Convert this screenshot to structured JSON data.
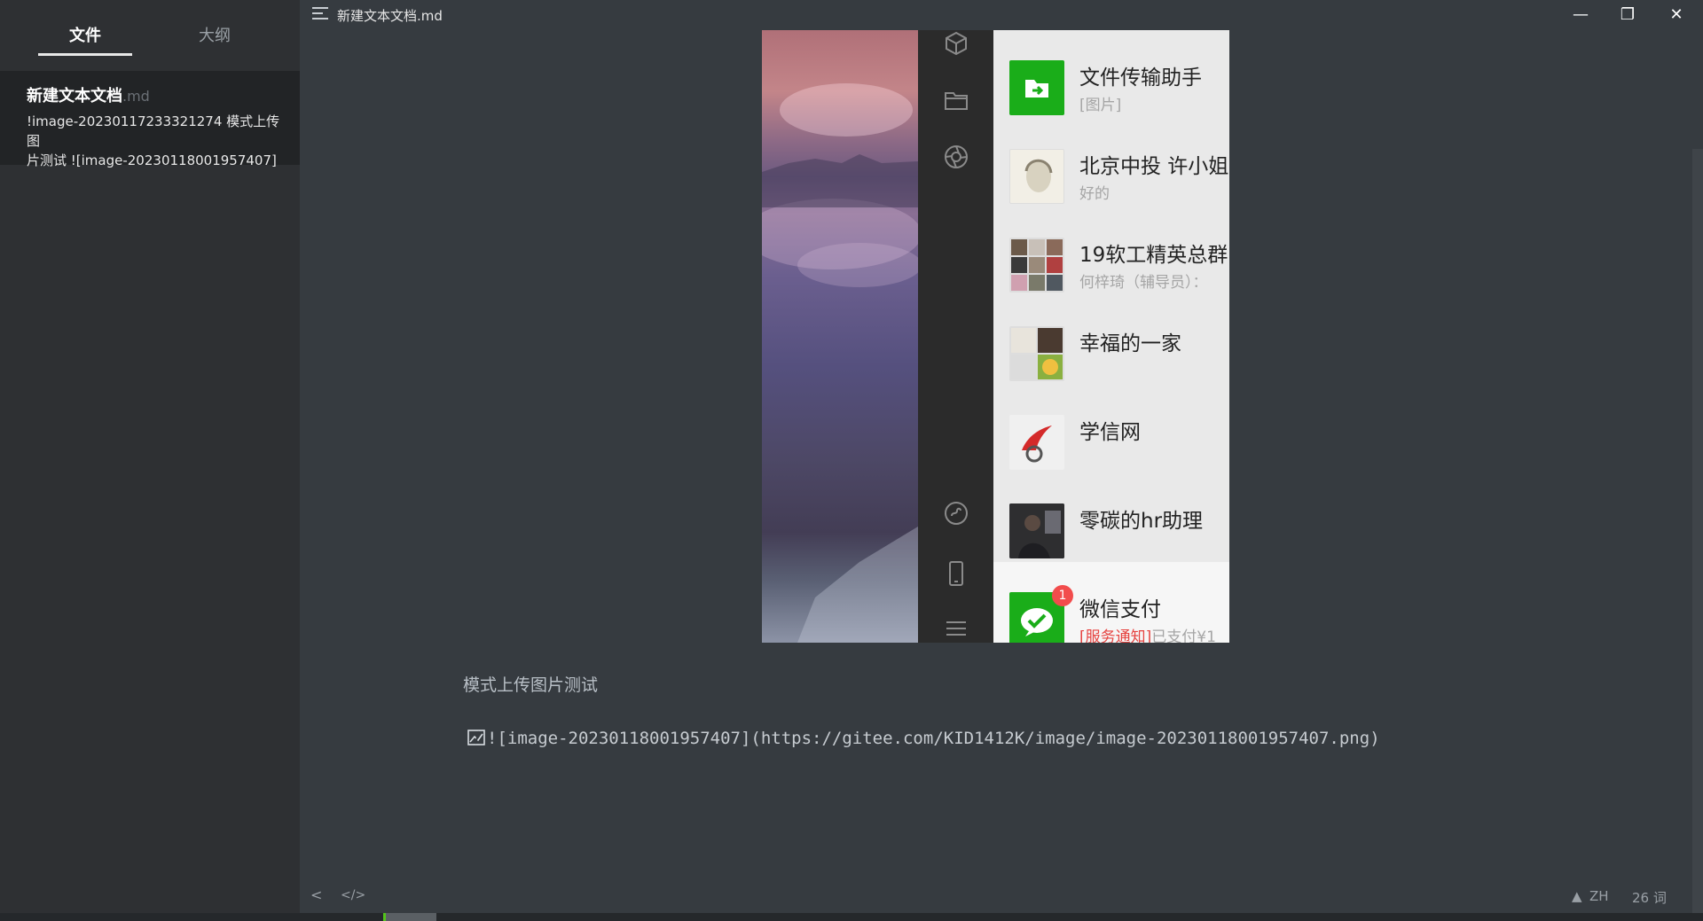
{
  "sidebar": {
    "tabs": [
      {
        "label": "文件",
        "active": true
      },
      {
        "label": "大纲",
        "active": false
      }
    ],
    "file_item": {
      "title": "新建文本文档",
      "ext": ".md",
      "excerpt_line1": "!image-20230117233321274 模式上传图",
      "excerpt_line2": "片测试 ![image-20230118001957407]"
    }
  },
  "titlebar": {
    "doc_title": "新建文本文档.md",
    "minimize": "—",
    "maximize": "❐",
    "close": "✕"
  },
  "embedded_image": {
    "chats": [
      {
        "name": "文件传输助手",
        "preview": "[图片]"
      },
      {
        "name": "北京中投 许小姐",
        "preview": "好的"
      },
      {
        "name": "19软工精英总群",
        "preview": "何梓琦（辅导员）："
      },
      {
        "name": "幸福的一家",
        "preview": ""
      },
      {
        "name": "学信网",
        "preview": ""
      },
      {
        "name": "零碳的hr助理",
        "preview": ""
      },
      {
        "name": "微信支付",
        "preview_red": "[服务通知]",
        "preview": "已支付¥1",
        "badge": "1"
      }
    ]
  },
  "document": {
    "paragraph": "模式上传图片测试",
    "code_line": "![image-20230118001957407](https://gitee.com/KID1412K/image/image-20230118001957407.png)"
  },
  "footer": {
    "back_icon": "<",
    "source_icon": "</>",
    "warning_icon": "▲",
    "lang": "ZH",
    "word_count": "26 词"
  },
  "colors": {
    "wechat_green": "#1aad19",
    "badge_red": "#f24c4c",
    "status_green": "#52c41a"
  }
}
